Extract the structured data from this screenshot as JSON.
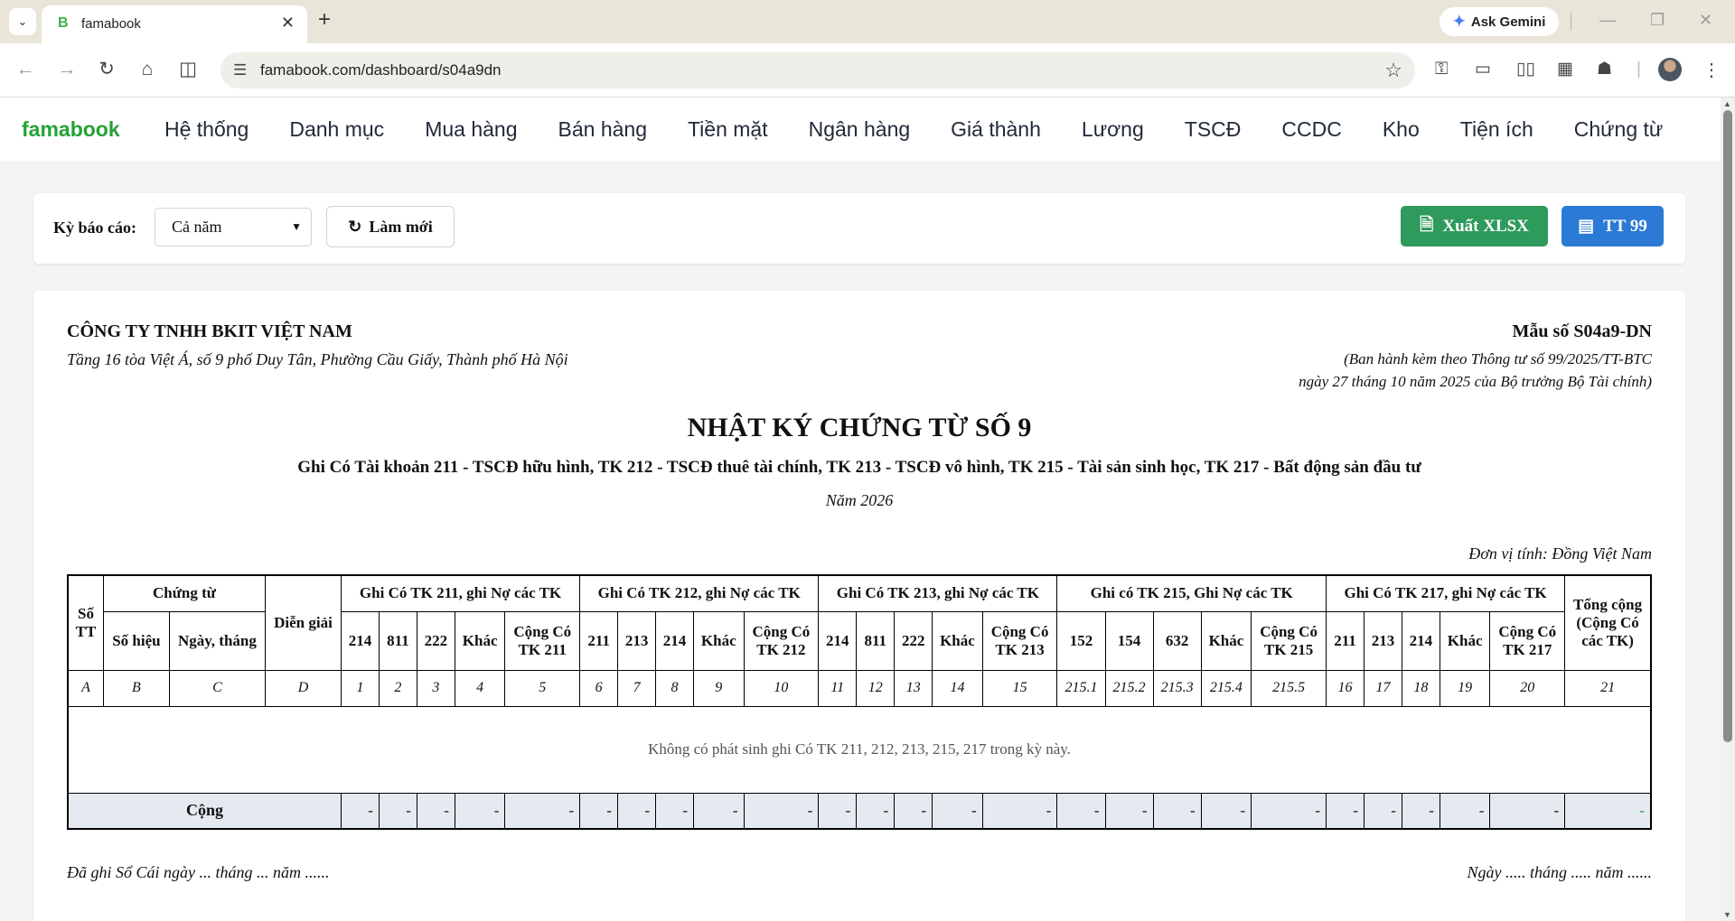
{
  "browser": {
    "tab_title": "famabook",
    "tab_favicon": "B",
    "new_tab": "+",
    "gemini_label": "Ask Gemini",
    "url": "famabook.com/dashboard/s04a9dn"
  },
  "app": {
    "brand": "famabook",
    "brand_color": "#22a336",
    "menu": [
      "Hệ thống",
      "Danh mục",
      "Mua hàng",
      "Bán hàng",
      "Tiền mặt",
      "Ngân hàng",
      "Giá thành",
      "Lương",
      "TSCĐ",
      "CCDC",
      "Kho",
      "Tiện ích",
      "Chứng từ"
    ]
  },
  "filter": {
    "period_label": "Kỳ báo cáo:",
    "period_value": "Cả năm",
    "refresh_label": "Làm mới",
    "export_label": "Xuất XLSX",
    "export_color": "#2e9a5b",
    "tt_label": "TT 99",
    "tt_color": "#2a7ad6"
  },
  "report": {
    "company_name": "CÔNG TY TNHH BKIT VIỆT NAM",
    "company_address": "Tầng 16 tòa Việt Á, số 9 phố Duy Tân, Phường Cầu Giấy, Thành phố Hà Nội",
    "form_number": "Mẫu số S04a9-DN",
    "form_note_1": "(Ban hành kèm theo Thông tư số 99/2025/TT-BTC",
    "form_note_2": "ngày 27 tháng 10 năm 2025 của Bộ trưởng Bộ Tài chính)",
    "title": "NHẬT KÝ CHỨNG TỪ SỐ 9",
    "subtitle": "Ghi Có Tài khoản 211 - TSCĐ hữu hình, TK 212 - TSCĐ thuê tài chính, TK 213 - TSCĐ vô hình, TK 215 - Tài sản sinh học, TK 217 - Bất động sản đầu tư",
    "year": "Năm 2026",
    "unit": "Đơn vị tính: Đồng Việt Nam",
    "table": {
      "stt": "Số TT",
      "chung_tu": "Chứng từ",
      "so_hieu": "Số hiệu",
      "ngay_thang": "Ngày, tháng",
      "dien_giai": "Diễn giải",
      "groups": [
        {
          "title": "Ghi Có TK 211, ghi Nợ các TK",
          "cols": [
            "214",
            "811",
            "222",
            "Khác",
            "Cộng Có TK 211"
          ]
        },
        {
          "title": "Ghi Có TK 212, ghi Nợ các TK",
          "cols": [
            "211",
            "213",
            "214",
            "Khác",
            "Cộng Có TK 212"
          ]
        },
        {
          "title": "Ghi Có TK 213, ghi Nợ các TK",
          "cols": [
            "214",
            "811",
            "222",
            "Khác",
            "Cộng Có TK 213"
          ]
        },
        {
          "title": "Ghi có TK 215, Ghi Nợ các TK",
          "cols": [
            "152",
            "154",
            "632",
            "Khác",
            "Cộng Có TK 215"
          ]
        },
        {
          "title": "Ghi Có TK 217, ghi Nợ các TK",
          "cols": [
            "211",
            "213",
            "214",
            "Khác",
            "Cộng Có TK 217"
          ]
        }
      ],
      "total_col": "Tổng cộng (Cộng Có các TK)",
      "index_row": [
        "A",
        "B",
        "C",
        "D",
        "1",
        "2",
        "3",
        "4",
        "5",
        "6",
        "7",
        "8",
        "9",
        "10",
        "11",
        "12",
        "13",
        "14",
        "15",
        "215.1",
        "215.2",
        "215.3",
        "215.4",
        "215.5",
        "16",
        "17",
        "18",
        "19",
        "20",
        "21"
      ],
      "empty_message": "Không có phát sinh ghi Có TK 211, 212, 213, 215, 217 trong kỳ này.",
      "total_label": "Cộng",
      "total_values": [
        "-",
        "-",
        "-",
        "-",
        "-",
        "-",
        "-",
        "-",
        "-",
        "-",
        "-",
        "-",
        "-",
        "-",
        "-",
        "-",
        "-",
        "-",
        "-",
        "-",
        "-",
        "-",
        "-",
        "-",
        "-",
        "-"
      ]
    },
    "sign_left": "Đã ghi Sổ Cái ngày ... tháng ... năm ......",
    "sign_right": "Ngày ..... tháng ..... năm ......"
  }
}
